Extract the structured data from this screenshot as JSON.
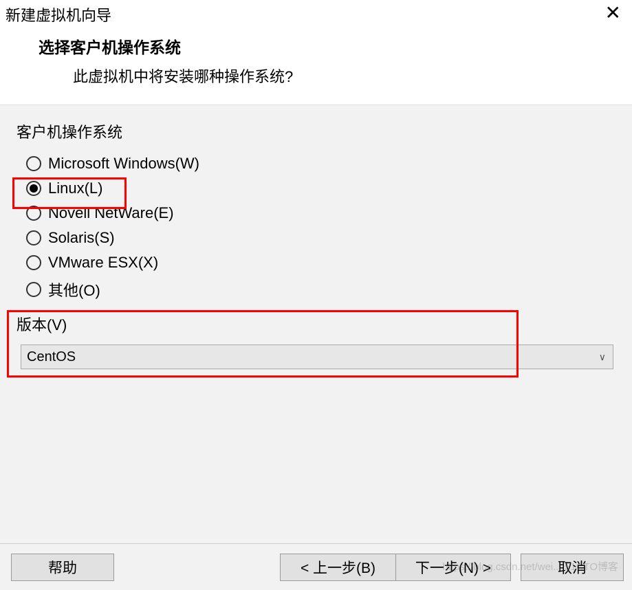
{
  "window": {
    "title": "新建虚拟机向导"
  },
  "header": {
    "title": "选择客户机操作系统",
    "subtitle": "此虚拟机中将安装哪种操作系统?"
  },
  "os_group": {
    "label": "客户机操作系统",
    "options": [
      {
        "label": "Microsoft Windows(W)",
        "selected": false
      },
      {
        "label": "Linux(L)",
        "selected": true
      },
      {
        "label": "Novell NetWare(E)",
        "selected": false
      },
      {
        "label": "Solaris(S)",
        "selected": false
      },
      {
        "label": "VMware ESX(X)",
        "selected": false
      },
      {
        "label": "其他(O)",
        "selected": false
      }
    ]
  },
  "version": {
    "label": "版本(V)",
    "selected": "CentOS"
  },
  "buttons": {
    "help": "帮助",
    "back": "< 上一步(B)",
    "next": "下一步(N) >",
    "cancel": "取消"
  },
  "watermark": "https://blog.csdn.net/wei... 51CTO博客"
}
